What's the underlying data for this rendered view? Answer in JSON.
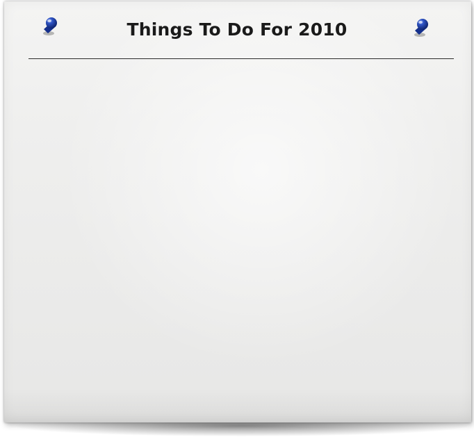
{
  "note": {
    "title": "Things To Do For 2010",
    "pin_color": "#1f3fa8",
    "paper_color": "#efefee"
  },
  "icons": {
    "left_pin": "pushpin-icon",
    "right_pin": "pushpin-icon"
  }
}
